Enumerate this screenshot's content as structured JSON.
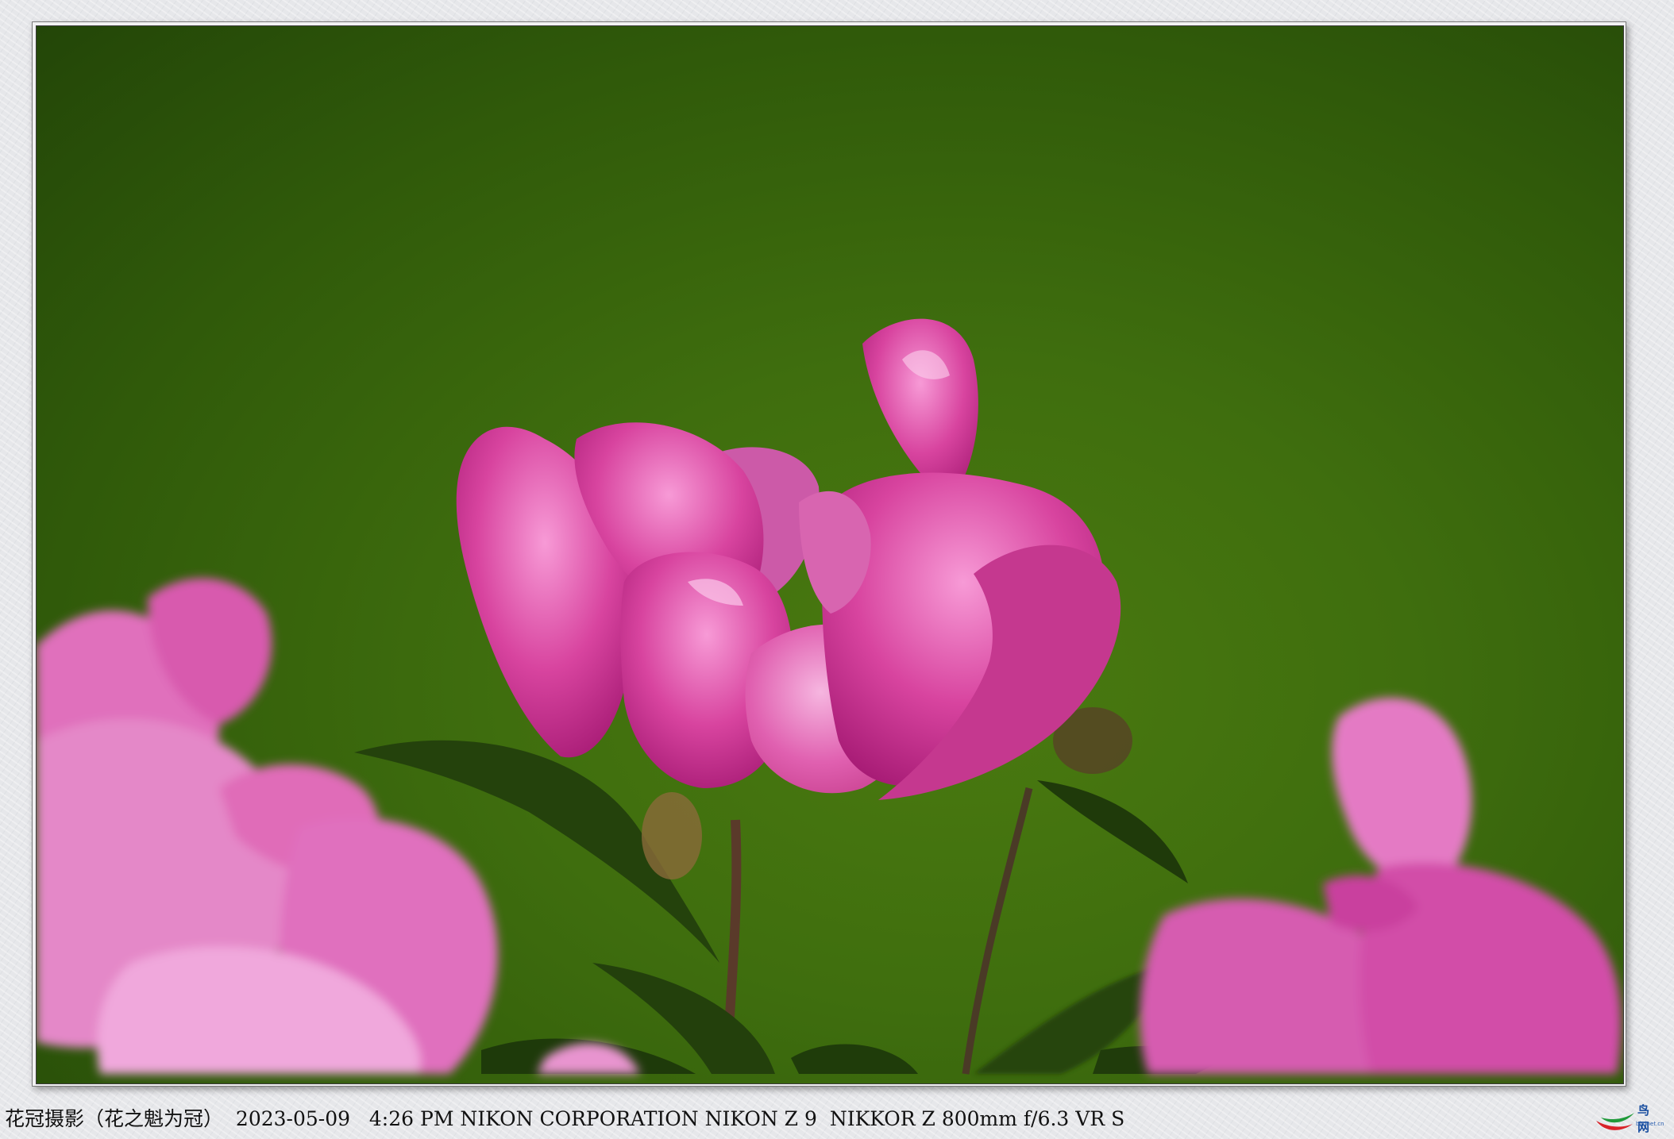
{
  "caption": {
    "title": "花冠摄影（花之魁为冠）",
    "date": "2023-05-09",
    "time": "4:26 PM",
    "camera_make": "NIKON CORPORATION",
    "camera_model": "NIKON Z 9",
    "lens": "NIKKOR Z 800mm f/6.3 VR S"
  },
  "logo": {
    "name": "鸟网",
    "site": "birdnet.cn"
  },
  "photo": {
    "subject": "pink-peony-flowers",
    "colors": {
      "background": "#3f6e0e",
      "petal": "#d0409a",
      "petal_light": "#f08ccc",
      "leaf": "#24420c"
    }
  }
}
